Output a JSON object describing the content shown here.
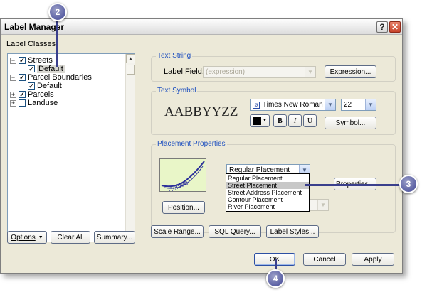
{
  "window": {
    "title": "Label Manager",
    "help_glyph": "?",
    "close_glyph": "✕"
  },
  "label_classes": {
    "heading": "Label Classes",
    "items": [
      {
        "toggle": "−",
        "checked": true,
        "label": "Streets"
      },
      {
        "checked": true,
        "label": "Default"
      },
      {
        "toggle": "−",
        "checked": true,
        "label": "Parcel Boundaries"
      },
      {
        "checked": true,
        "label": "Default"
      },
      {
        "toggle": "+",
        "checked": true,
        "label": "Parcels"
      },
      {
        "toggle": "+",
        "checked": false,
        "label": "Landuse"
      }
    ]
  },
  "left_buttons": {
    "options": "Options",
    "clear_all": "Clear All",
    "summary": "Summary..."
  },
  "text_string": {
    "group_title": "Text String",
    "label_field_label": "Label Field:",
    "label_field_value": "(expression)",
    "expression_button": "Expression..."
  },
  "text_symbol": {
    "group_title": "Text Symbol",
    "preview": "AABBYYZZ",
    "font": "Times New Roman",
    "size": "22",
    "bold": "B",
    "italic": "I",
    "underline": "U",
    "symbol_button": "Symbol...",
    "color": "#000000"
  },
  "placement": {
    "group_title": "Placement Properties",
    "preview_text": "Curved",
    "selected": "Regular Placement",
    "options": [
      "Regular Placement",
      "Street Placement",
      "Street Address Placement",
      "Contour Placement",
      "River Placement"
    ],
    "highlighted_index": 1,
    "properties_button": "Properties...",
    "position_button": "Position..."
  },
  "bottom_buttons": {
    "scale_range": "Scale Range...",
    "sql_query": "SQL Query...",
    "label_styles": "Label Styles..."
  },
  "dialog_buttons": {
    "ok": "OK",
    "cancel": "Cancel",
    "apply": "Apply"
  },
  "callouts": {
    "c2": "2",
    "c3": "3",
    "c4": "4"
  },
  "icons": {
    "dropdown": "▼",
    "scroll_up": "▲",
    "scroll_down": "▼",
    "font_type": "ø",
    "check": "✓"
  },
  "colors": {
    "callout": "#3f4594",
    "group_title": "#1d4fbf",
    "preview_fill": "#e9f6c8",
    "preview_line": "#2b2f9a"
  }
}
